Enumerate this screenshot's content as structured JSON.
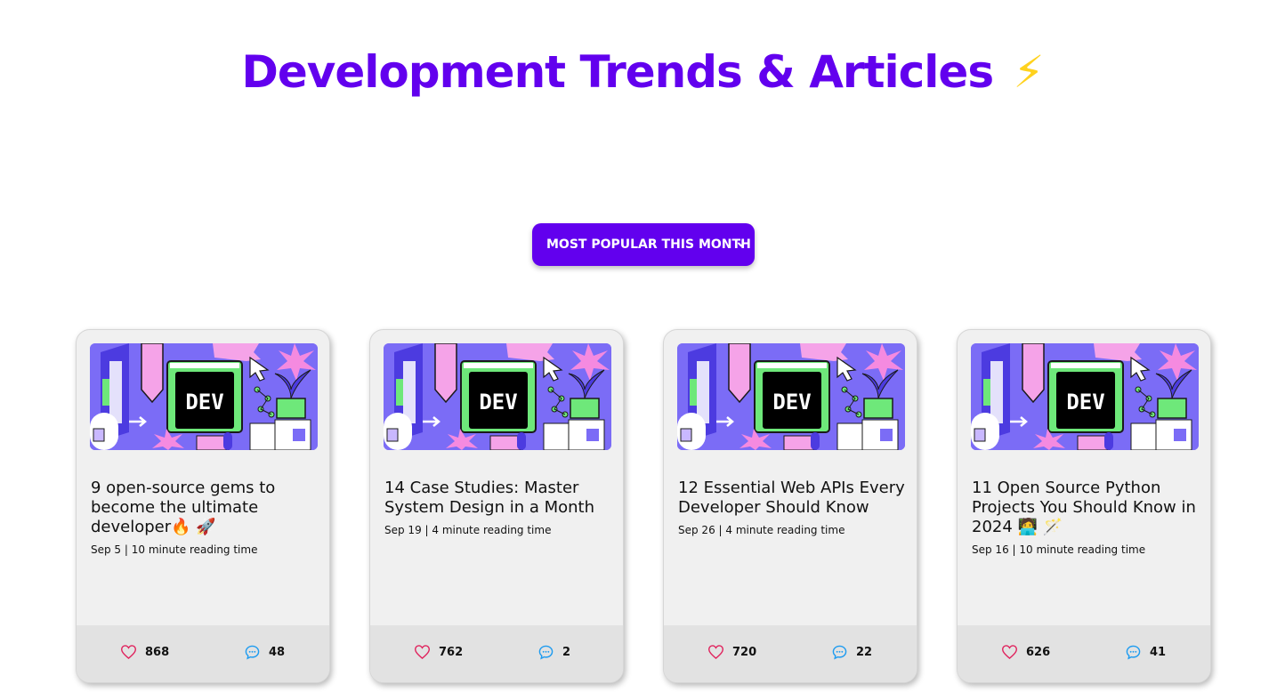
{
  "header": {
    "title": "Development Trends & Articles",
    "title_emoji": "⚡"
  },
  "filter": {
    "selected": "MOST POPULAR THIS MONTH",
    "icon": "chevron-down-icon"
  },
  "colors": {
    "accent": "#6200ee",
    "like_icon": "#e0245e",
    "comment_icon": "#1d9bf0",
    "card_bg": "#f0f0f0",
    "footer_bg": "#e2e2e2"
  },
  "cover_badge": "DEV",
  "articles": [
    {
      "title": "9 open-source gems to become the ultimate developer🔥 🚀",
      "date": "Sep 5",
      "reading": "10 minute reading time",
      "meta": "Sep 5 | 10 minute reading time",
      "likes": "868",
      "comments": "48"
    },
    {
      "title": "14 Case Studies: Master System Design in a Month",
      "date": "Sep 19",
      "reading": "4 minute reading time",
      "meta": "Sep 19 | 4 minute reading time",
      "likes": "762",
      "comments": "2"
    },
    {
      "title": "12 Essential Web APIs Every Developer Should Know",
      "date": "Sep 26",
      "reading": "4 minute reading time",
      "meta": "Sep 26 | 4 minute reading time",
      "likes": "720",
      "comments": "22"
    },
    {
      "title": "11 Open Source Python Projects You Should Know in 2024 🧑‍💻 🪄",
      "date": "Sep 16",
      "reading": "10 minute reading time",
      "meta": "Sep 16 | 10 minute reading time",
      "likes": "626",
      "comments": "41"
    }
  ]
}
